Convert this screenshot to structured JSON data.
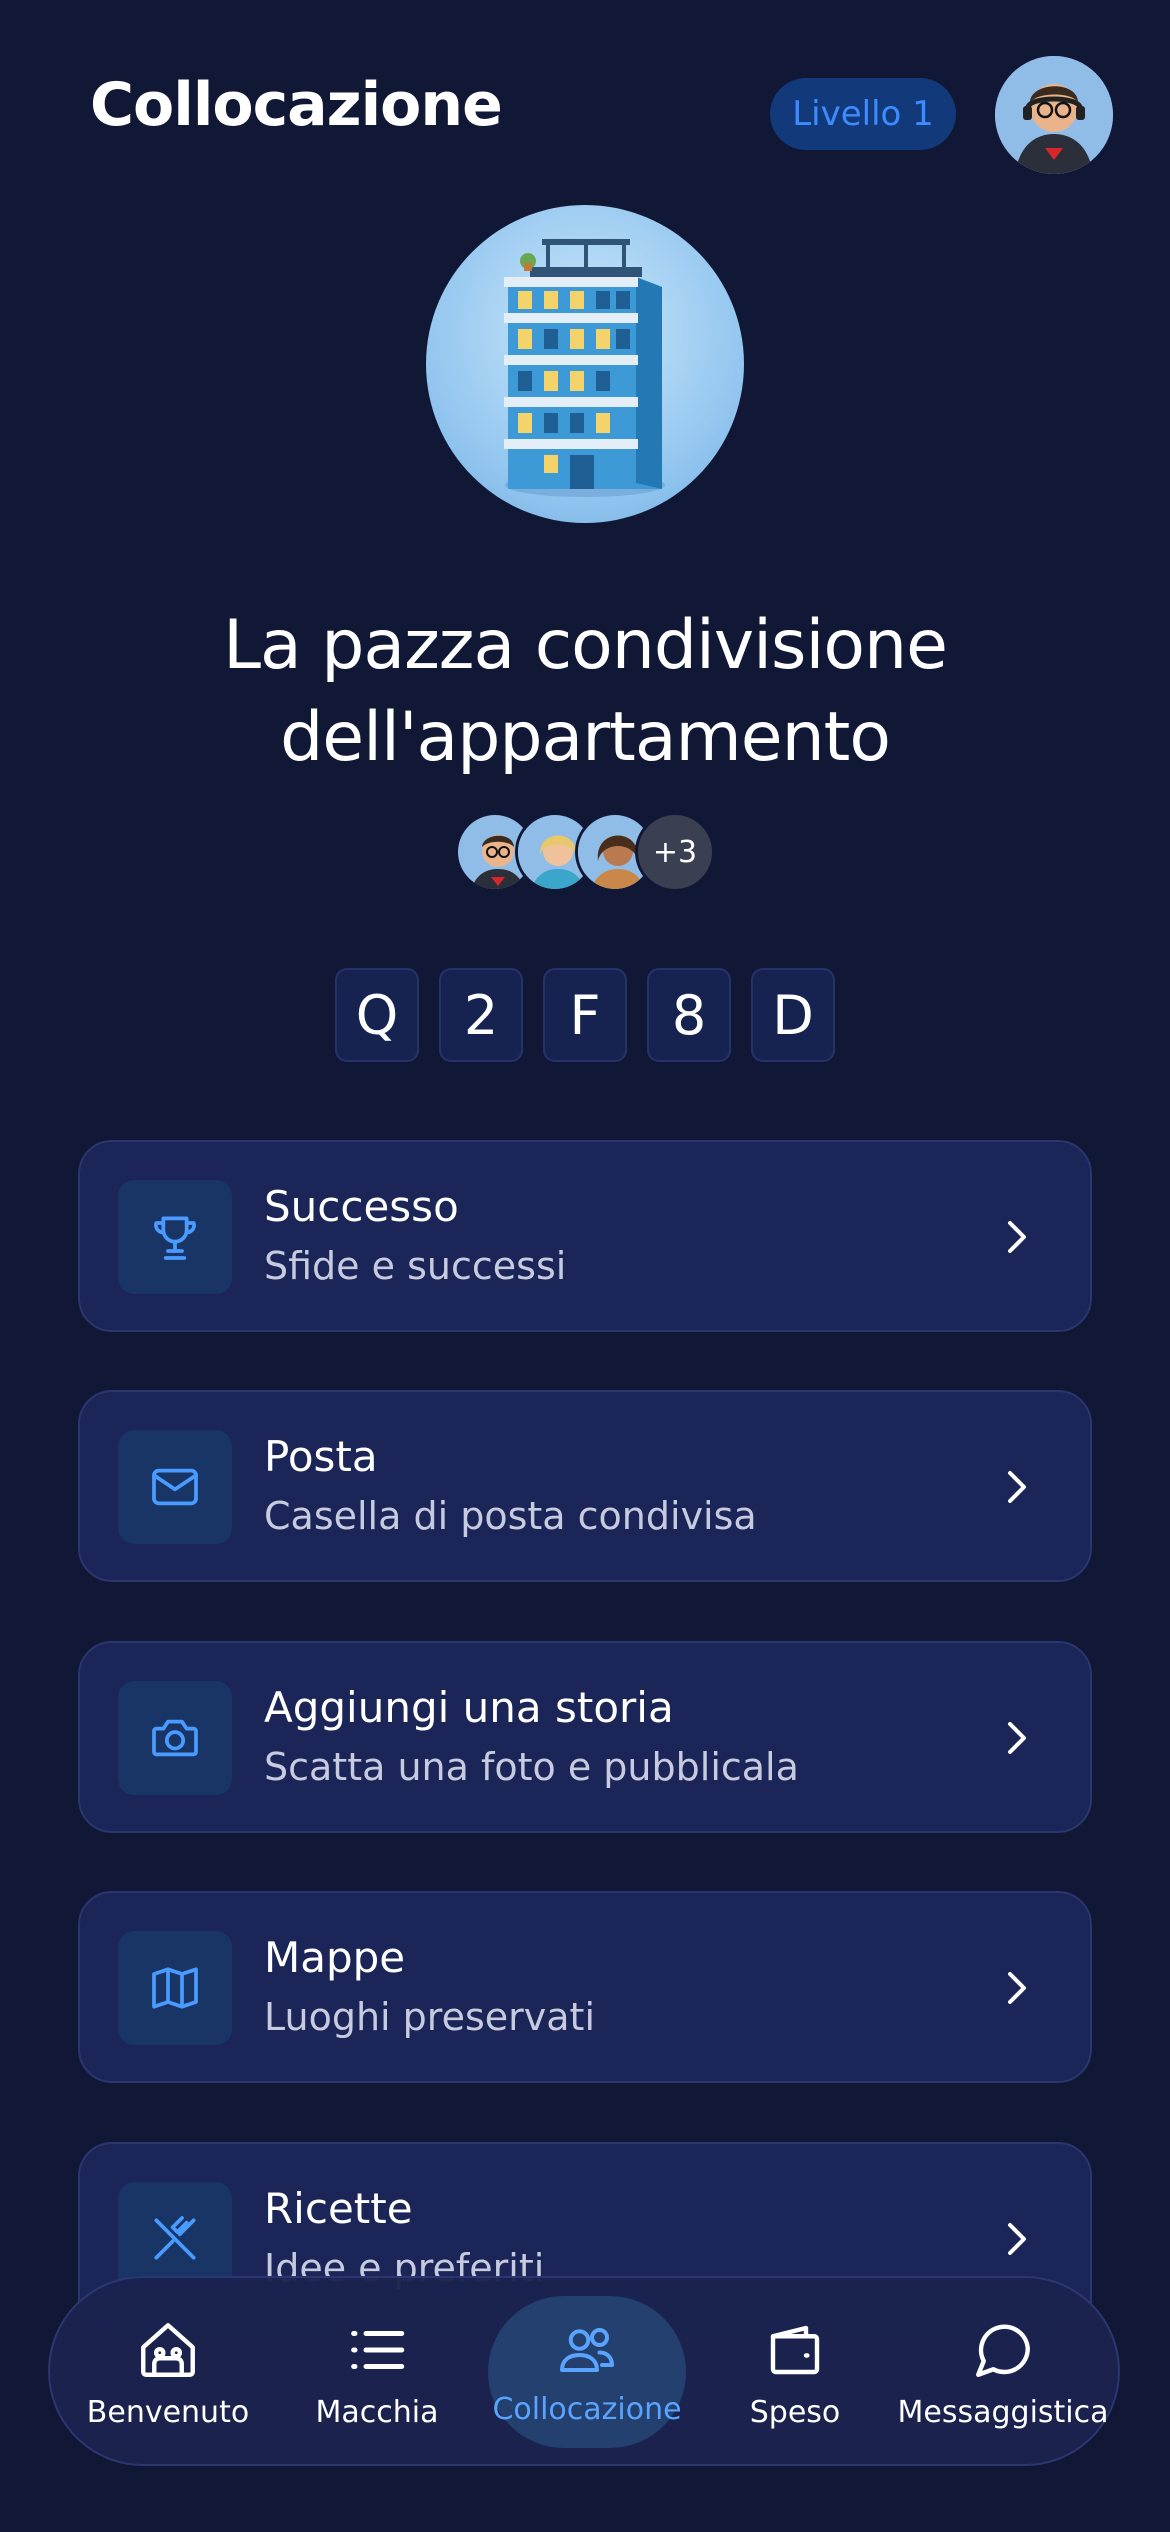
{
  "header": {
    "title": "Collocazione",
    "level_badge": "Livello 1"
  },
  "group": {
    "name_line1": "La pazza condivisione",
    "name_line2": "dell'appartamento",
    "extra_members": "+3",
    "code": [
      "Q",
      "2",
      "F",
      "8",
      "D"
    ]
  },
  "menu": [
    {
      "title": "Successo",
      "subtitle": "Sfide e successi",
      "icon": "trophy-icon"
    },
    {
      "title": "Posta",
      "subtitle": "Casella di posta condivisa",
      "icon": "mail-icon"
    },
    {
      "title": "Aggiungi una storia",
      "subtitle": "Scatta una foto e pubblicala",
      "icon": "camera-icon"
    },
    {
      "title": "Mappe",
      "subtitle": "Luoghi preservati",
      "icon": "map-icon"
    },
    {
      "title": "Ricette",
      "subtitle": "Idee e preferiti",
      "icon": "utensils-icon"
    }
  ],
  "nav": [
    {
      "label": "Benvenuto",
      "icon": "home-icon",
      "active": false
    },
    {
      "label": "Macchia",
      "icon": "list-icon",
      "active": false
    },
    {
      "label": "Collocazione",
      "icon": "people-icon",
      "active": true
    },
    {
      "label": "Speso",
      "icon": "wallet-icon",
      "active": false
    },
    {
      "label": "Messaggistica",
      "icon": "chat-icon",
      "active": false
    }
  ],
  "colors": {
    "background": "#111836",
    "card": "#1b2557",
    "accent": "#3d8cff",
    "active_nav": "#5aa4ff"
  }
}
